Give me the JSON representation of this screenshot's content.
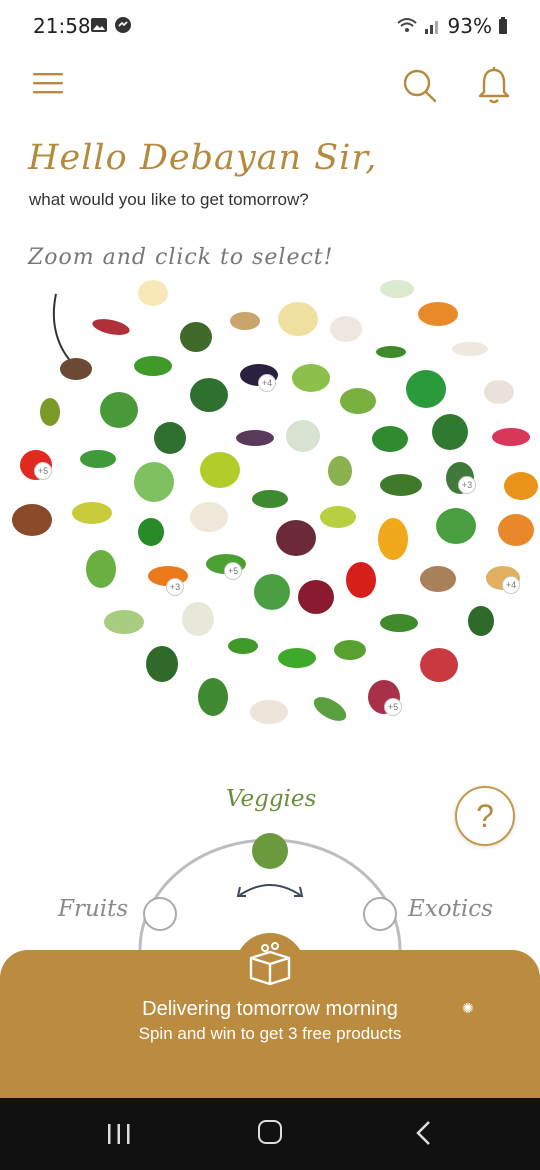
{
  "status": {
    "time": "21:58",
    "battery": "93%"
  },
  "greeting": {
    "title": "Hello Debayan Sir,",
    "subtitle": "what would you like to get tomorrow?",
    "hint": "Zoom and click to select!"
  },
  "produce_badges": {
    "tomato": "+5",
    "eggplant": "+4",
    "cucumber": "+3",
    "carrot": "+3",
    "beans": "+5",
    "potato": "+4",
    "onion": "+5"
  },
  "categories": {
    "left": "Fruits",
    "center": "Veggies",
    "right": "Exotics"
  },
  "help": {
    "label": "?"
  },
  "delivery": {
    "title": "Delivering tomorrow morning",
    "subtitle": "Spin and win to get 3 free products"
  },
  "colors": {
    "brand": "#bb8b3f",
    "accent_green": "#6b8e3a"
  },
  "icons": {
    "menu": "menu-icon",
    "search": "search-icon",
    "notifications": "bell-icon",
    "box": "box-icon"
  }
}
